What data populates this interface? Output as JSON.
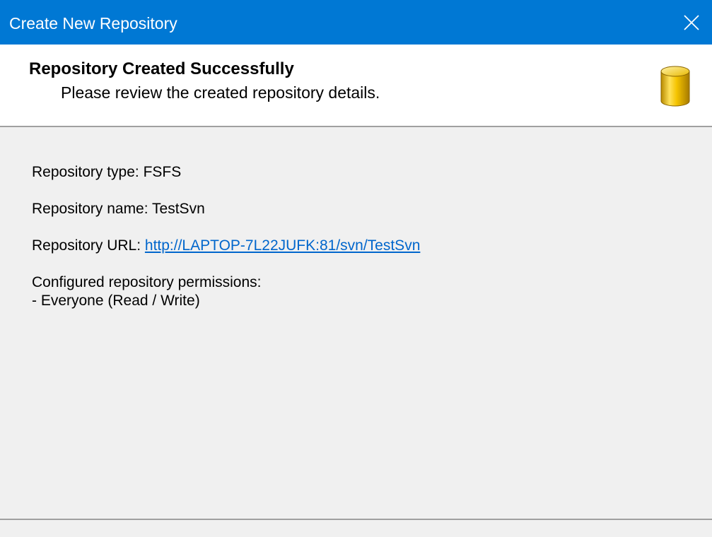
{
  "window": {
    "title": "Create New Repository",
    "close_icon": "close-icon",
    "accent_color": "#0078d4"
  },
  "header": {
    "title": "Repository Created Successfully",
    "subtitle": "Please review the created repository details.",
    "icon": "database-icon"
  },
  "details": {
    "type_label": "Repository type:",
    "type_value": "FSFS",
    "name_label": "Repository name:",
    "name_value": "TestSvn",
    "url_label": "Repository URL:",
    "url_value": "http://LAPTOP-7L22JUFK:81/svn/TestSvn",
    "permissions_label": "Configured repository permissions:",
    "permissions_value": "- Everyone (Read / Write)"
  }
}
